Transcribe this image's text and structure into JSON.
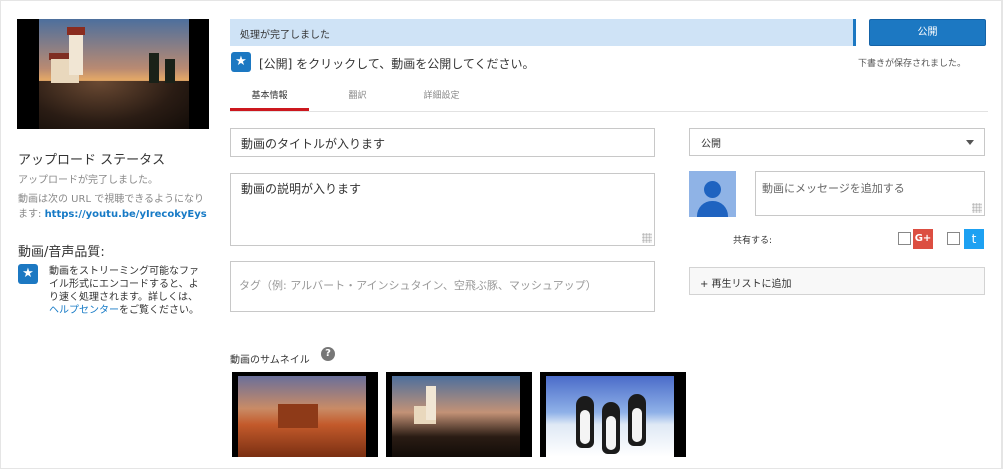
{
  "left": {
    "status_title": "アップロード ステータス",
    "status_sub": "アップロードが完了しました。",
    "status_desc": "動画は次の URL で視聴できるようになります: ",
    "status_url": "https://youtu.be/yIrecokyEys",
    "quality_title": "動画/音声品質:",
    "quality_desc_1": "動画をストリーミング可能なファイル形式にエンコードすると、より速く処理されます。詳しくは、",
    "quality_link": "ヘルプセンター",
    "quality_desc_2": "をご覧ください。"
  },
  "top": {
    "progress_text": "処理が完了しました",
    "publish_label": "公開",
    "hint_text": "[公開] をクリックして、動画を公開してください。",
    "saved_text": "下書きが保存されました。"
  },
  "tabs": [
    {
      "label": "基本情報",
      "active": true
    },
    {
      "label": "翻訳",
      "active": false
    },
    {
      "label": "詳細設定",
      "active": false
    }
  ],
  "form": {
    "title_value": "動画のタイトルが入ります",
    "desc_value": "動画の説明が入ります",
    "tags_placeholder": "タグ（例: アルバート・アインシュタイン、空飛ぶ豚、マッシュアップ）"
  },
  "right": {
    "privacy_value": "公開",
    "message_placeholder": "動画にメッセージを追加する",
    "share_label": "共有する:",
    "gplus_label": "G+",
    "twitter_label": "t",
    "playlist_label": "+ 再生リストに追加"
  },
  "thumbnails": {
    "label": "動画のサムネイル",
    "help": "?"
  },
  "icons": {
    "info": "star-icon",
    "help": "question-icon"
  },
  "colors": {
    "accent": "#1c78c2",
    "active_tab": "#cc181e",
    "progress_bg": "#cfe3f6"
  }
}
